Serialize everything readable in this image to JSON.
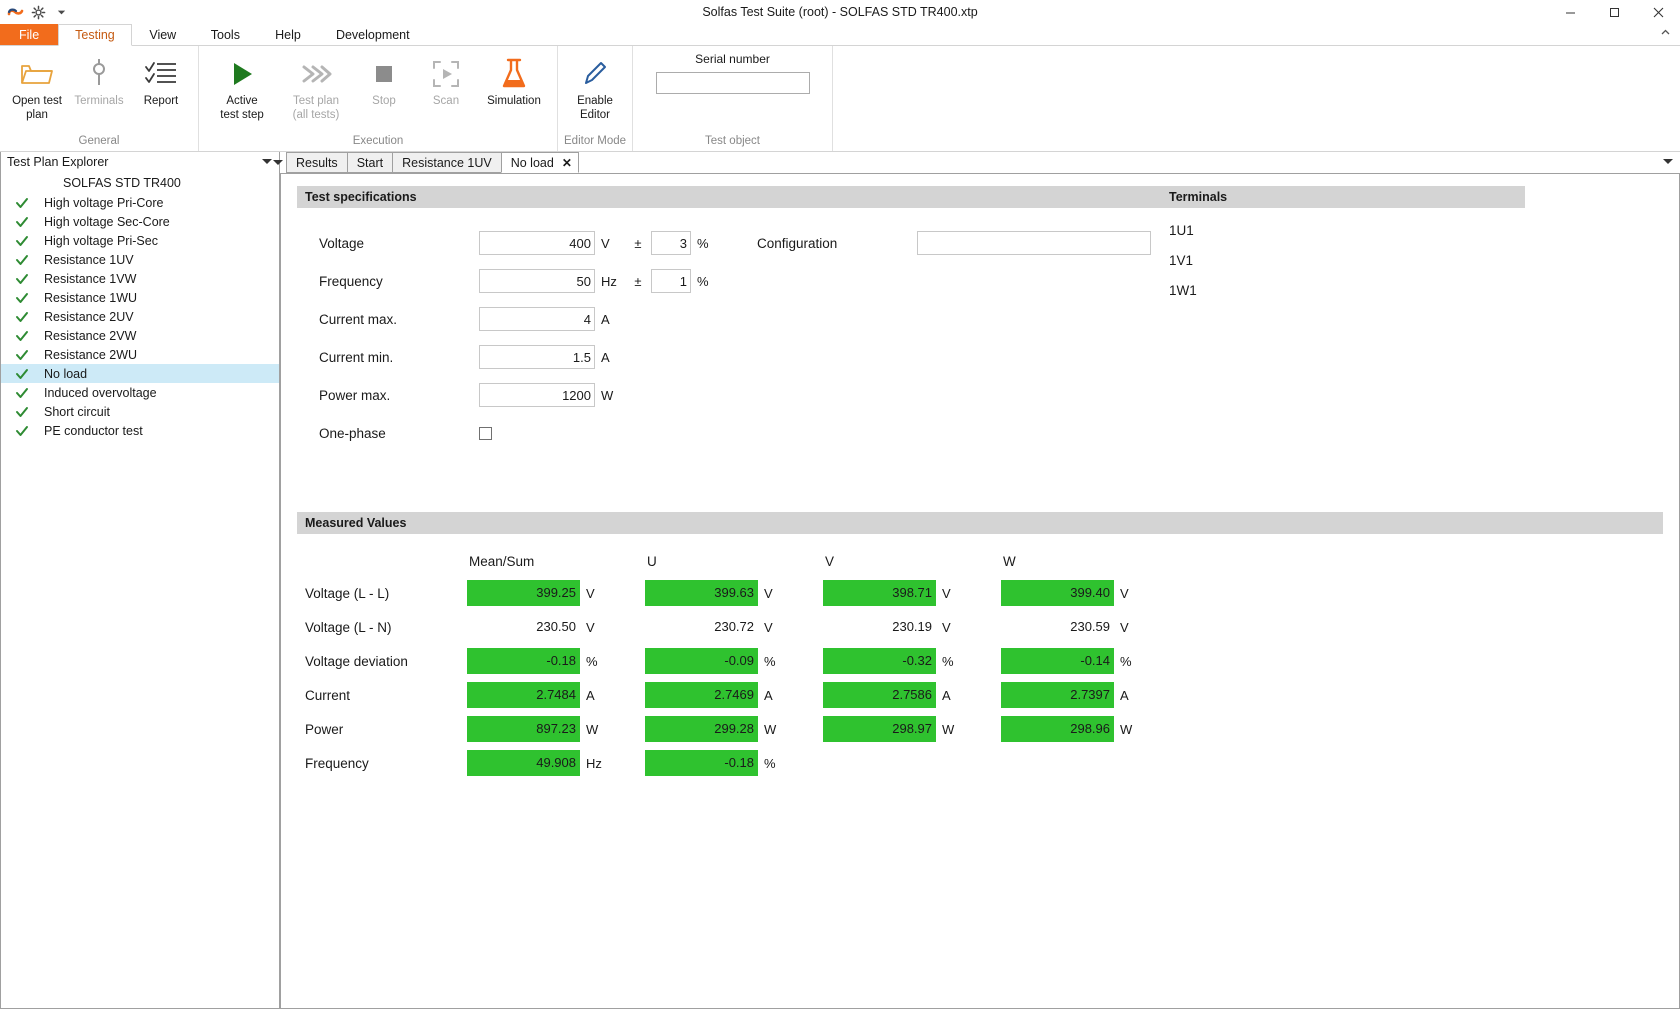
{
  "window": {
    "title": "Solfas Test Suite (root)  - SOLFAS STD TR400.xtp",
    "minimize": "—",
    "maximize": "▢",
    "close": "✕",
    "qat_icons": [
      "app-logo-icon",
      "gear-icon",
      "chevron-down-icon"
    ],
    "ribbon_collapse": "^"
  },
  "ribbon": {
    "tabs": [
      {
        "label": "File",
        "active": false,
        "kind": "file"
      },
      {
        "label": "Testing",
        "active": true,
        "kind": "normal"
      },
      {
        "label": "View",
        "active": false,
        "kind": "normal"
      },
      {
        "label": "Tools",
        "active": false,
        "kind": "normal"
      },
      {
        "label": "Help",
        "active": false,
        "kind": "normal"
      },
      {
        "label": "Development",
        "active": false,
        "kind": "normal"
      }
    ],
    "groups": [
      {
        "label": "General",
        "buttons": [
          {
            "label": "Open test\nplan",
            "icon": "folder-open-icon",
            "disabled": false
          },
          {
            "label": "Terminals",
            "icon": "terminals-icon",
            "disabled": true
          },
          {
            "label": "Report",
            "icon": "report-checklist-icon",
            "disabled": false
          }
        ]
      },
      {
        "label": "Execution",
        "buttons": [
          {
            "label": "Active\ntest step",
            "icon": "play-triangle-icon",
            "disabled": false
          },
          {
            "label": "Test plan\n(all tests)",
            "icon": "fast-forward-icon",
            "disabled": true
          },
          {
            "label": "Stop",
            "icon": "stop-square-icon",
            "disabled": true
          },
          {
            "label": "Scan",
            "icon": "scan-frame-icon",
            "disabled": true
          },
          {
            "label": "Simulation",
            "icon": "flask-icon",
            "disabled": false
          }
        ]
      },
      {
        "label": "Editor Mode",
        "buttons": [
          {
            "label": "Enable\nEditor",
            "icon": "pencil-icon",
            "disabled": false
          }
        ]
      },
      {
        "label": "Test object",
        "serial_label": "Serial number",
        "serial_value": "",
        "serial_placeholder": ""
      }
    ]
  },
  "sidebar": {
    "title": "Test Plan Explorer",
    "root": "SOLFAS STD TR400",
    "items": [
      {
        "label": "High voltage Pri-Core",
        "status": "pass",
        "selected": false
      },
      {
        "label": "High voltage Sec-Core",
        "status": "pass",
        "selected": false
      },
      {
        "label": "High voltage Pri-Sec",
        "status": "pass",
        "selected": false
      },
      {
        "label": "Resistance 1UV",
        "status": "pass",
        "selected": false
      },
      {
        "label": "Resistance 1VW",
        "status": "pass",
        "selected": false
      },
      {
        "label": "Resistance 1WU",
        "status": "pass",
        "selected": false
      },
      {
        "label": "Resistance 2UV",
        "status": "pass",
        "selected": false
      },
      {
        "label": "Resistance 2VW",
        "status": "pass",
        "selected": false
      },
      {
        "label": "Resistance 2WU",
        "status": "pass",
        "selected": false
      },
      {
        "label": "No load",
        "status": "pass",
        "selected": true
      },
      {
        "label": "Induced overvoltage",
        "status": "pass",
        "selected": false
      },
      {
        "label": "Short circuit",
        "status": "pass",
        "selected": false
      },
      {
        "label": "PE conductor test",
        "status": "pass",
        "selected": false
      }
    ]
  },
  "document_tabs": [
    {
      "label": "Results",
      "active": false,
      "closable": false
    },
    {
      "label": "Start",
      "active": false,
      "closable": false
    },
    {
      "label": "Resistance 1UV",
      "active": false,
      "closable": false
    },
    {
      "label": "No load",
      "active": true,
      "closable": true,
      "close_glyph": "✕"
    }
  ],
  "test_specifications": {
    "header": "Test specifications",
    "rows": [
      {
        "label": "Voltage",
        "value": "400",
        "unit": "V",
        "tol_sign": "±",
        "tol_value": "3",
        "tol_unit": "%"
      },
      {
        "label": "Frequency",
        "value": "50",
        "unit": "Hz",
        "tol_sign": "±",
        "tol_value": "1",
        "tol_unit": "%"
      },
      {
        "label": "Current max.",
        "value": "4",
        "unit": "A",
        "tol_sign": "",
        "tol_value": "",
        "tol_unit": ""
      },
      {
        "label": "Current min.",
        "value": "1.5",
        "unit": "A",
        "tol_sign": "",
        "tol_value": "",
        "tol_unit": ""
      },
      {
        "label": "Power max.",
        "value": "1200",
        "unit": "W",
        "tol_sign": "",
        "tol_value": "",
        "tol_unit": ""
      }
    ],
    "one_phase_label": "One-phase",
    "one_phase_checked": false,
    "configuration_label": "Configuration",
    "configuration_value": ""
  },
  "terminals": {
    "header": "Terminals",
    "items": [
      "1U1",
      "1V1",
      "1W1"
    ]
  },
  "measured_values": {
    "header": "Measured Values",
    "columns": [
      "Mean/Sum",
      "U",
      "V",
      "W"
    ],
    "rows": [
      {
        "label": "Voltage (L - L)",
        "cells": [
          {
            "value": "399.25",
            "unit": "V",
            "ok": true
          },
          {
            "value": "399.63",
            "unit": "V",
            "ok": true
          },
          {
            "value": "398.71",
            "unit": "V",
            "ok": true
          },
          {
            "value": "399.40",
            "unit": "V",
            "ok": true
          }
        ]
      },
      {
        "label": "Voltage (L - N)",
        "cells": [
          {
            "value": "230.50",
            "unit": "V",
            "ok": false
          },
          {
            "value": "230.72",
            "unit": "V",
            "ok": false
          },
          {
            "value": "230.19",
            "unit": "V",
            "ok": false
          },
          {
            "value": "230.59",
            "unit": "V",
            "ok": false
          }
        ]
      },
      {
        "label": "Voltage deviation",
        "cells": [
          {
            "value": "-0.18",
            "unit": "%",
            "ok": true
          },
          {
            "value": "-0.09",
            "unit": "%",
            "ok": true
          },
          {
            "value": "-0.32",
            "unit": "%",
            "ok": true
          },
          {
            "value": "-0.14",
            "unit": "%",
            "ok": true
          }
        ]
      },
      {
        "label": "Current",
        "cells": [
          {
            "value": "2.7484",
            "unit": "A",
            "ok": true
          },
          {
            "value": "2.7469",
            "unit": "A",
            "ok": true
          },
          {
            "value": "2.7586",
            "unit": "A",
            "ok": true
          },
          {
            "value": "2.7397",
            "unit": "A",
            "ok": true
          }
        ]
      },
      {
        "label": "Power",
        "cells": [
          {
            "value": "897.23",
            "unit": "W",
            "ok": true
          },
          {
            "value": "299.28",
            "unit": "W",
            "ok": true
          },
          {
            "value": "298.97",
            "unit": "W",
            "ok": true
          },
          {
            "value": "298.96",
            "unit": "W",
            "ok": true
          }
        ]
      },
      {
        "label": "Frequency",
        "cells": [
          {
            "value": "49.908",
            "unit": "Hz",
            "ok": true
          },
          {
            "value": "-0.18",
            "unit": "%",
            "ok": true
          },
          {
            "value": "",
            "unit": "",
            "ok": false
          },
          {
            "value": "",
            "unit": "",
            "ok": false
          }
        ]
      }
    ]
  },
  "colors": {
    "accent_orange": "#f26c1c",
    "pass_green": "#2fc22f",
    "check_green": "#2e8b33",
    "selection_blue": "#cdeaf7",
    "section_header_gray": "#d4d4d4"
  }
}
